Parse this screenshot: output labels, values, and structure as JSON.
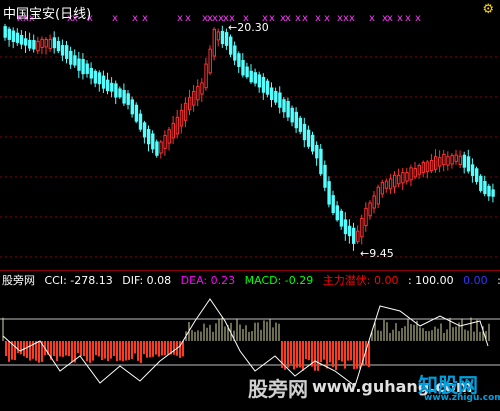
{
  "header": {
    "title": "中国宝安(日线)",
    "settings_icon": "gear-icon"
  },
  "price_panel": {
    "high_label": "20.30",
    "low_label": "9.45",
    "up_color": "#ff3333",
    "down_color": "#55ffff",
    "signal_mark": "x",
    "signal_color": "#ff33ff"
  },
  "indicator_bar": {
    "name": "股旁网",
    "cci_label": "CCI: -278.13",
    "dif_label": "DIF: 0.08",
    "dea_label": "DEA: 0.23",
    "macd_label": "MACD: -0.29",
    "zhuli_label": "主力潜伏: 0.00",
    "val1_label": ": 100.00",
    "val2_label": "0.00",
    "val3_label": ":-"
  },
  "watermark": {
    "site_cn": "股旁网",
    "site_url": "www.guhang.com",
    "site_logo": "知股网",
    "site_logo_url": "www.zhigu.com"
  },
  "colors": {
    "dif": "#ffffff",
    "dea": "#ff00ff",
    "macd": "#00ff00",
    "zhuli": "#ff0000",
    "cci": "#ffffff",
    "gridline": "#8b0000"
  }
}
